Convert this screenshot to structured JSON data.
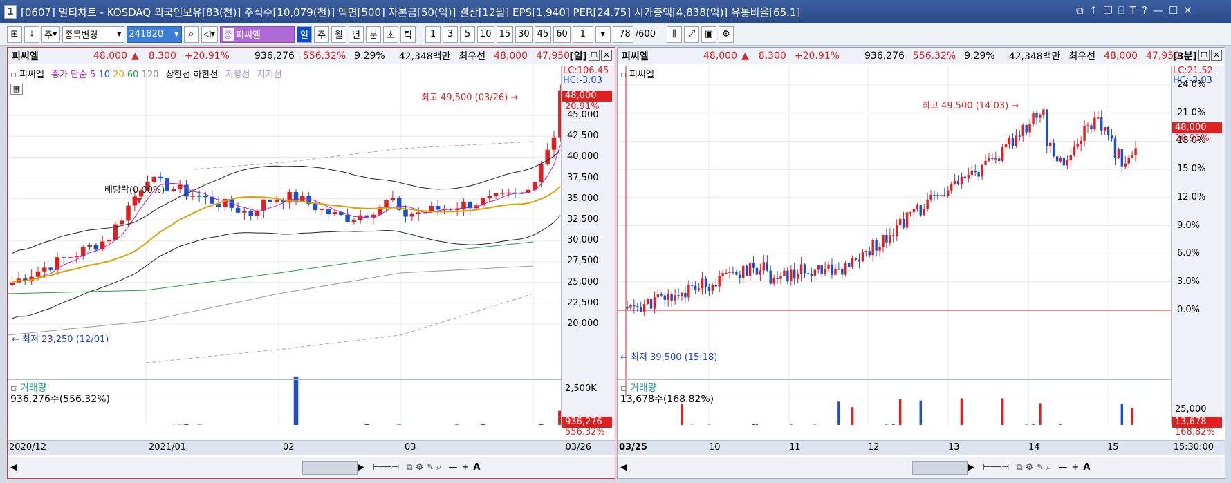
{
  "titlebar": {
    "num": "1",
    "text": "[0607] 멀티차트 - KOSDAQ 외국인보유[83(천)] 주식수[10,079(천)] 액면[500] 자본금[50(억)] 결산[12월] EPS[1,940] PER[24.75] 시가총액[4,838(억)] 유통비율[65.1]"
  },
  "toolbar": {
    "type_select": "주",
    "change_select": "종목변경",
    "code_input": "241820",
    "stock_name": "피씨엘",
    "periods": [
      "일",
      "주",
      "월",
      "년",
      "분",
      "초",
      "틱"
    ],
    "numbers": [
      "1",
      "3",
      "5",
      "10",
      "15",
      "30",
      "45",
      "60"
    ],
    "count_value": "1",
    "page_value": "78",
    "page_total": "/600"
  },
  "left": {
    "info": {
      "name": "피씨엘",
      "price": "48,000",
      "arrow": "▲",
      "change": "8,300",
      "pct": "+20.91%",
      "volume": "936,276",
      "vol_pct": "556.32%",
      "turnover": "9.29%",
      "amount": "42,348백만",
      "pref": "최우선",
      "bid": "48,000",
      "ask": "47,950",
      "period": "[일]"
    },
    "legend_name": "피씨엘",
    "legend_ma": "종가 단순",
    "ma_values": [
      "5",
      "10",
      "20",
      "60",
      "120"
    ],
    "legend_extra": [
      "상한선",
      "하한선",
      "저항선",
      "지지선"
    ],
    "high_label": "최고 49,500 (03/26)",
    "low_label": "최저 23,250 (12/01)",
    "div_label": "배당락(0,00%)",
    "lc": "LC:106.45",
    "hc": "HC:-3.03",
    "price_tag": "48,000",
    "pct_tag": "20.91%",
    "y_ticks": [
      "45,000",
      "42,500",
      "40,000",
      "37,500",
      "35,000",
      "32,500",
      "30,000",
      "27,500",
      "25,000",
      "22,500",
      "20,000"
    ],
    "vol_title": "거래량",
    "vol_value": "936,276주(556.32%)",
    "vol_top": "2,500K",
    "vol_tag": "936,276",
    "vol_pct_tag": "556.32%",
    "x_ticks": [
      "2020/12",
      "2021/01",
      "02",
      "03"
    ],
    "x_right": "03/26"
  },
  "right": {
    "info": {
      "name": "피씨엘",
      "price": "48,000",
      "arrow": "▲",
      "change": "8,300",
      "pct": "+20.91%",
      "volume": "936,276",
      "vol_pct": "556.32%",
      "turnover": "9.29%",
      "amount": "42,348백만",
      "pref": "최우선",
      "bid": "48,000",
      "ask": "47,950",
      "period": "[3분]"
    },
    "legend_name": "피씨엘",
    "high_label": "최고 49,500 (14:03)",
    "low_label": "최저 39,500 (15:18)",
    "lc": "LC:21.52",
    "hc": "HC:-3.03",
    "price_tag": "48,000",
    "pct_tag": "20.91%",
    "y_ticks": [
      "24.0%",
      "21.0%",
      "18.0%",
      "15.0%",
      "12.0%",
      "9.0%",
      "6.0%",
      "3.0%",
      "0.0%"
    ],
    "vol_title": "거래량",
    "vol_value": "13,678주(168.82%)",
    "vol_top": "25,000",
    "vol_tag": "13,678",
    "vol_pct_tag": "168.82%",
    "x_ticks": [
      "03/25",
      "10",
      "11",
      "12",
      "13",
      "14",
      "15"
    ],
    "x_right": "15:30:00"
  },
  "chart_data": [
    {
      "type": "candlestick",
      "title": "피씨엘 일봉",
      "ylim": [
        20000,
        49500
      ],
      "high": 49500,
      "low": 23250,
      "last": 48000
    },
    {
      "type": "candlestick",
      "title": "피씨엘 3분봉",
      "ylim": [
        0,
        24
      ],
      "high": 49500,
      "low": 39500,
      "last": 48000
    }
  ],
  "colors": {
    "up": "#e02020",
    "down": "#1a4fd0",
    "accent": "#2a4a88"
  }
}
